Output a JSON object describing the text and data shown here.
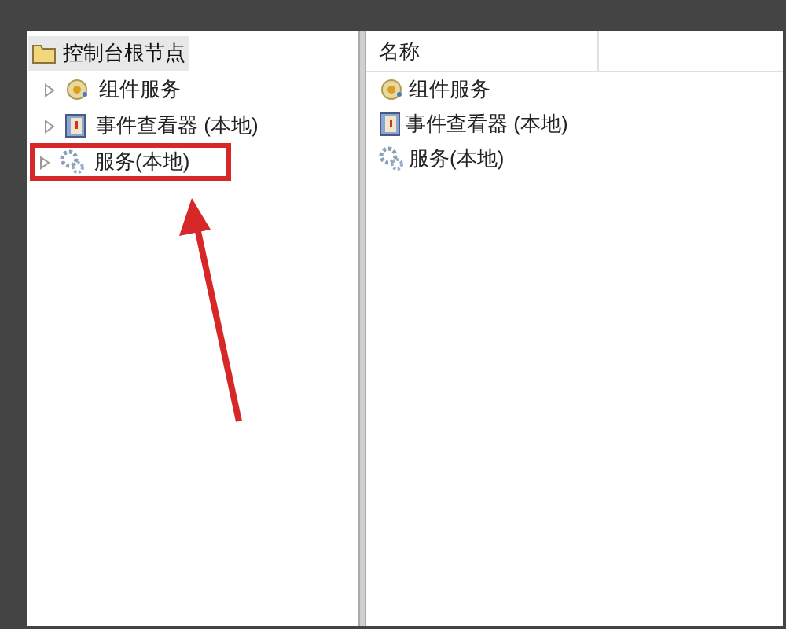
{
  "tree": {
    "root": {
      "label": "控制台根节点",
      "kind": "folder",
      "selected": true
    },
    "items": [
      {
        "label": "组件服务",
        "kind": "component",
        "expanded": false,
        "highlighted": false
      },
      {
        "label": "事件查看器 (本地)",
        "kind": "event",
        "expanded": false,
        "highlighted": false
      },
      {
        "label": "服务(本地)",
        "kind": "services",
        "expanded": false,
        "highlighted": true
      }
    ]
  },
  "list": {
    "columns": [
      "名称"
    ],
    "rows": [
      {
        "label": "组件服务",
        "kind": "component"
      },
      {
        "label": "事件查看器 (本地)",
        "kind": "event"
      },
      {
        "label": "服务(本地)",
        "kind": "services"
      }
    ]
  }
}
